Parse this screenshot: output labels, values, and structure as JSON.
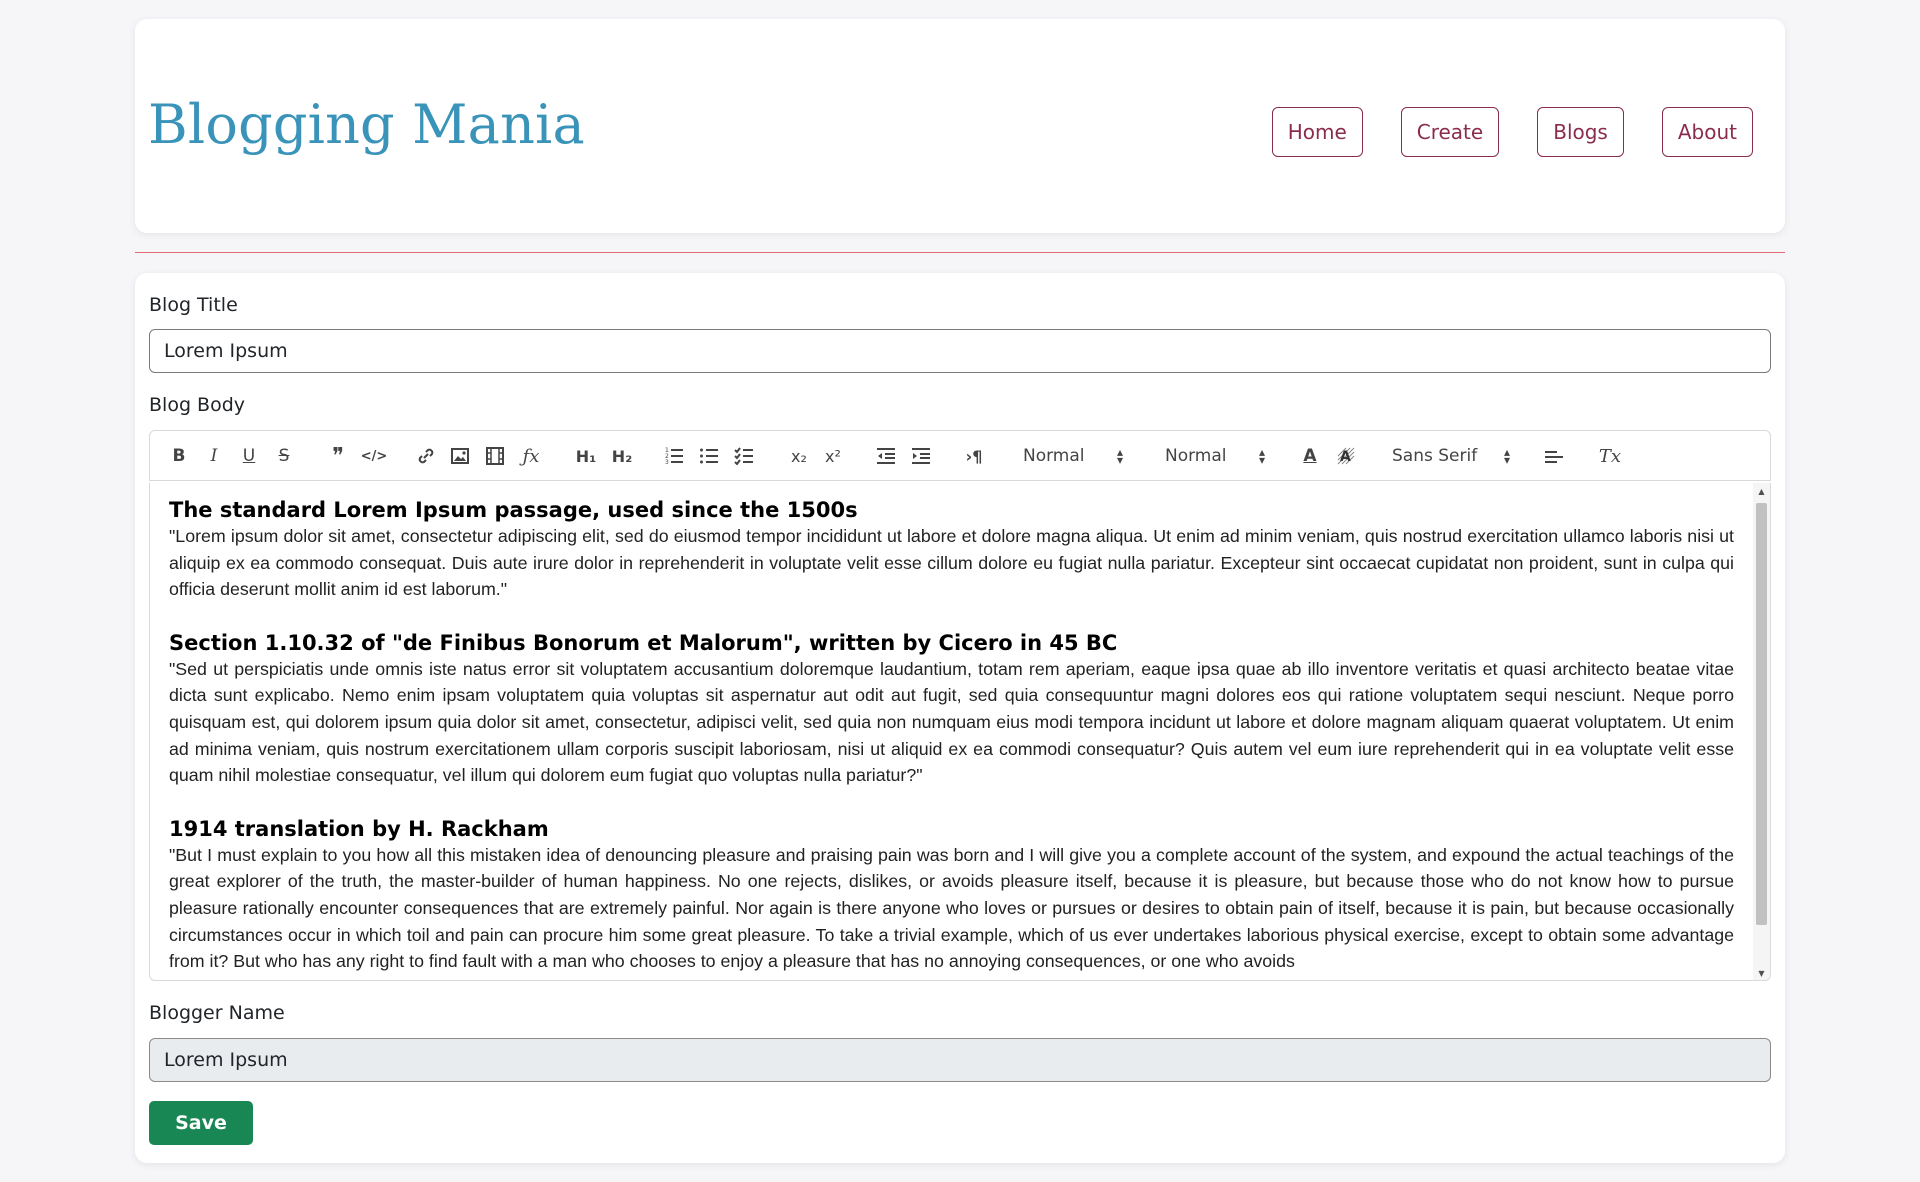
{
  "brand": {
    "title": "Blogging Mania",
    "color": "#3a93b8"
  },
  "nav": {
    "items": [
      "Home",
      "Create",
      "Blogs",
      "About"
    ],
    "color": "#8b2c4e"
  },
  "form": {
    "title_label": "Blog Title",
    "title_value": "Lorem Ipsum",
    "body_label": "Blog Body",
    "blogger_label": "Blogger Name",
    "blogger_value": "Lorem Ipsum",
    "save_label": "Save",
    "save_color": "#198754"
  },
  "toolbar": {
    "buttons": {
      "bold": "B",
      "italic": "I",
      "underline": "U",
      "strike": "S",
      "blockquote": "❞",
      "code_block": "</>",
      "link": "🔗",
      "image": "image",
      "video": "video",
      "formula": "ƒx",
      "h1": "H₁",
      "h2": "H₂",
      "ordered_list": "ordered-list",
      "bullet_list": "bullet-list",
      "check_list": "check-list",
      "subscript": "x₂",
      "superscript": "x²",
      "indent_decrease": "outdent",
      "indent_increase": "indent",
      "direction": "›¶",
      "color": "A",
      "background": "A",
      "align": "align",
      "clean": "Tx"
    },
    "header_select": "Normal",
    "size_select": "Normal",
    "font_select": "Sans Serif"
  },
  "body": {
    "sections": [
      {
        "heading": "The standard Lorem Ipsum passage, used since the 1500s",
        "text": "\"Lorem ipsum dolor sit amet, consectetur adipiscing elit, sed do eiusmod tempor incididunt ut labore et dolore magna aliqua. Ut enim ad minim veniam, quis nostrud exercitation ullamco laboris nisi ut aliquip ex ea commodo consequat. Duis aute irure dolor in reprehenderit in voluptate velit esse cillum dolore eu fugiat nulla pariatur. Excepteur sint occaecat cupidatat non proident, sunt in culpa qui officia deserunt mollit anim id est laborum.\""
      },
      {
        "heading": "Section 1.10.32 of \"de Finibus Bonorum et Malorum\", written by Cicero in 45 BC",
        "text": "\"Sed ut perspiciatis unde omnis iste natus error sit voluptatem accusantium doloremque laudantium, totam rem aperiam, eaque ipsa quae ab illo inventore veritatis et quasi architecto beatae vitae dicta sunt explicabo. Nemo enim ipsam voluptatem quia voluptas sit aspernatur aut odit aut fugit, sed quia consequuntur magni dolores eos qui ratione voluptatem sequi nesciunt. Neque porro quisquam est, qui dolorem ipsum quia dolor sit amet, consectetur, adipisci velit, sed quia non numquam eius modi tempora incidunt ut labore et dolore magnam aliquam quaerat voluptatem. Ut enim ad minima veniam, quis nostrum exercitationem ullam corporis suscipit laboriosam, nisi ut aliquid ex ea commodi consequatur? Quis autem vel eum iure reprehenderit qui in ea voluptate velit esse quam nihil molestiae consequatur, vel illum qui dolorem eum fugiat quo voluptas nulla pariatur?\""
      },
      {
        "heading": "1914 translation by H. Rackham",
        "text": "\"But I must explain to you how all this mistaken idea of denouncing pleasure and praising pain was born and I will give you a complete account of the system, and expound the actual teachings of the great explorer of the truth, the master-builder of human happiness. No one rejects, dislikes, or avoids pleasure itself, because it is pleasure, but because those who do not know how to pursue pleasure rationally encounter consequences that are extremely painful. Nor again is there anyone who loves or pursues or desires to obtain pain of itself, because it is pain, but because occasionally circumstances occur in which toil and pain can procure him some great pleasure. To take a trivial example, which of us ever undertakes laborious physical exercise, except to obtain some advantage from it? But who has any right to find fault with a man who chooses to enjoy a pleasure that has no annoying consequences, or one who avoids"
      }
    ]
  },
  "divider_color": "#e36a78"
}
